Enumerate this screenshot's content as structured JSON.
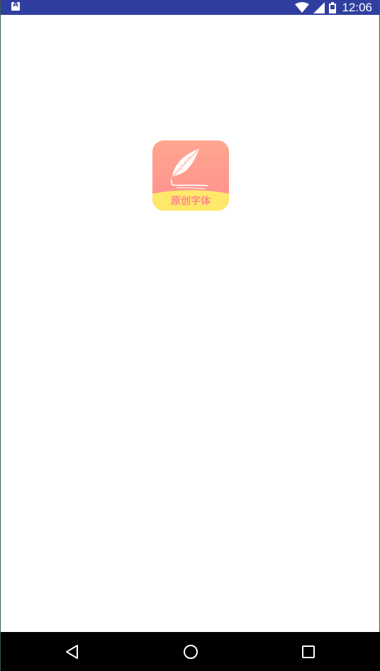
{
  "status_bar": {
    "notification_icon": "a-notification-icon",
    "notification_glyph": "A",
    "clock": "12:06",
    "icons": [
      "wifi-icon",
      "cell-signal-icon",
      "battery-icon"
    ],
    "background_color": "#303f9f"
  },
  "app_icon": {
    "name": "feather-logo-icon",
    "label": "原创字体",
    "gradient_top": "#ffa68e",
    "gradient_bottom": "#ff8f8f",
    "banner_color": "#ffe86a"
  },
  "nav_bar": {
    "back": "back-triangle-icon",
    "home": "home-circle-icon",
    "recents": "recents-square-icon",
    "background_color": "#000000"
  }
}
